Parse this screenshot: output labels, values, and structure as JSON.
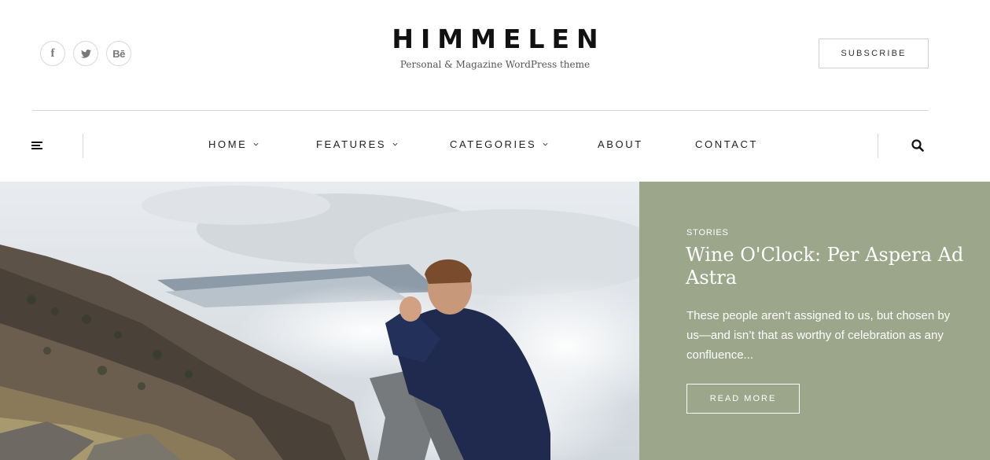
{
  "header": {
    "site_title": "HIMMELEN",
    "tagline": "Personal & Magazine WordPress theme",
    "subscribe_label": "SUBSCRIBE",
    "social": [
      {
        "icon": "facebook-icon",
        "glyph": "f"
      },
      {
        "icon": "twitter-icon"
      },
      {
        "icon": "behance-icon",
        "glyph": "Bē"
      }
    ]
  },
  "nav": {
    "items": [
      {
        "label": "HOME",
        "has_dropdown": true
      },
      {
        "label": "FEATURES",
        "has_dropdown": true
      },
      {
        "label": "CATEGORIES",
        "has_dropdown": true
      },
      {
        "label": "ABOUT",
        "has_dropdown": false
      },
      {
        "label": "CONTACT",
        "has_dropdown": false
      }
    ],
    "menu_icon": "hamburger-icon",
    "search_icon": "search-icon"
  },
  "hero": {
    "category": "STORIES",
    "title": "Wine O'Clock: Per Aspera Ad Astra",
    "excerpt": "These people aren’t assigned to us, but chosen by us—and isn’t that as worthy of celebration as any confluence...",
    "button_label": "READ MORE",
    "panel_color": "#9ba68a"
  }
}
